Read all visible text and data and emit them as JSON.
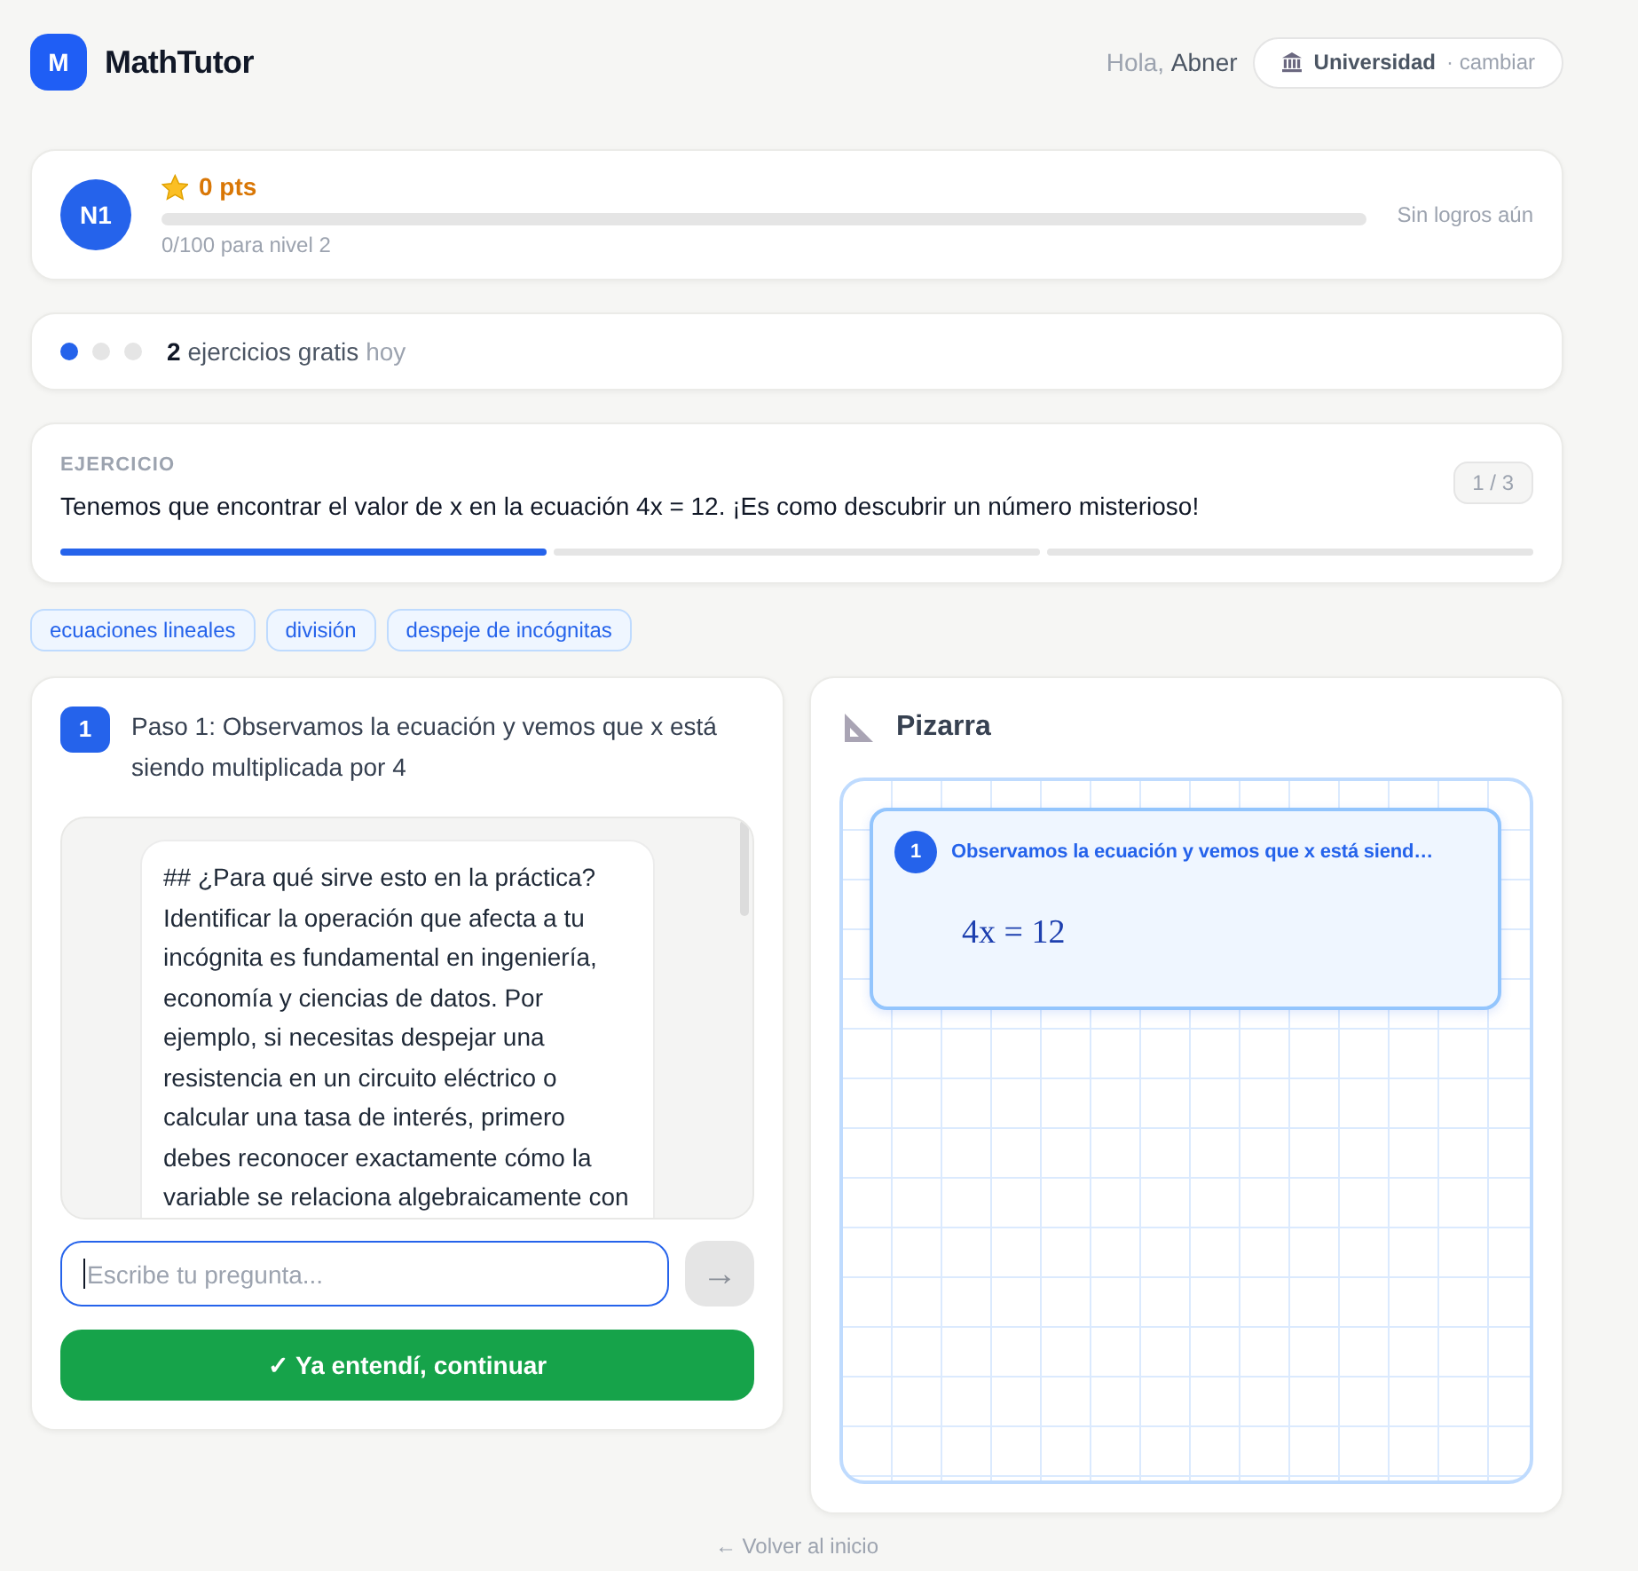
{
  "header": {
    "logo": {
      "letter": "M",
      "title": "MathTutor"
    },
    "greeting": "Hola,",
    "user_name": "Abner",
    "level_button": {
      "label": "Universidad",
      "action": "· cambiar"
    }
  },
  "level_card": {
    "badge": "N1",
    "points": "0 pts",
    "level": 0,
    "progress_text": "0/100 para nivel 2",
    "achievements": "Sin logros aún"
  },
  "free_exercises": {
    "dots": [
      {
        "on": true
      },
      {
        "on": false
      },
      {
        "on": false
      }
    ],
    "count": "2",
    "text": "ejercicios gratis",
    "suffix": "hoy"
  },
  "exercise": {
    "label": "EJERCICIO",
    "text": "Tenemos que encontrar el valor de x en la ecuación 4x = 12. ¡Es como descubrir un número misterioso!",
    "counter": "1 / 3",
    "segments": [
      {
        "done": true
      },
      {
        "done": false
      },
      {
        "done": false
      }
    ]
  },
  "tags": [
    "ecuaciones lineales",
    "división",
    "despeje de incógnitas"
  ],
  "step_panel": {
    "step": {
      "number": "1",
      "text": "Paso 1: Observamos la ecuación y vemos que x está siendo multiplicada por 4"
    },
    "messages": [
      {
        "text": "## ¿Para qué sirve esto en la práctica?\nIdentificar la operación que afecta a tu incógnita es fundamental en ingeniería, economía y ciencias de datos. Por ejemplo, si necesitas despejar una resistencia en un circuito eléctrico o calcular una tasa de interés, primero debes reconocer exactamente cómo la variable se relaciona algebraicamente con"
      }
    ],
    "input": {
      "placeholder": "Escribe tu pregunta...",
      "focused": true
    },
    "send_button": {
      "label": "→",
      "disabled": true
    },
    "continue_button": {
      "label": "✓ Ya entendí, continuar"
    }
  },
  "whiteboard": {
    "title": "Pizarra",
    "cards": [
      {
        "number": "1",
        "title": "Observamos la ecuación y vemos que x está siend…",
        "equation": "4x = 12"
      }
    ]
  },
  "footer": {
    "link": "← Volver al inicio"
  }
}
